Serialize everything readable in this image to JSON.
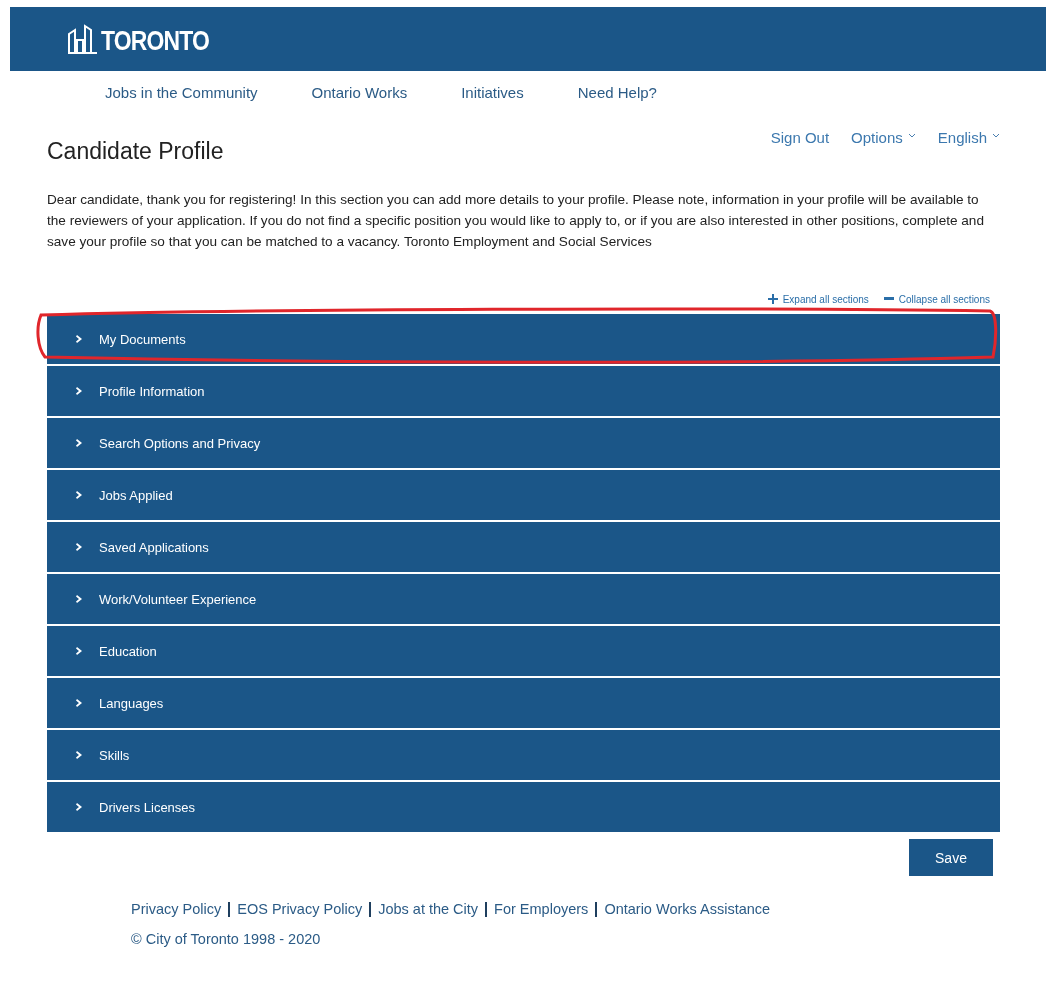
{
  "logo": {
    "text": "TORONTO"
  },
  "nav": [
    "Jobs in the Community",
    "Ontario Works",
    "Initiatives",
    "Need Help?"
  ],
  "user_menu": [
    {
      "label": "Sign Out",
      "dropdown": false
    },
    {
      "label": "Options",
      "dropdown": true
    },
    {
      "label": "English",
      "dropdown": true
    }
  ],
  "title": "Candidate Profile",
  "intro": "Dear candidate, thank you for registering! In this section you can add more details to your profile. Please note, information in your profile will be available to the reviewers of your application. If you do not find a specific position you would like to apply to, or if you are also interested in other positions, complete and save your profile so that you can be matched to a vacancy. Toronto Employment and Social Services",
  "section_controls": [
    {
      "kind": "expand",
      "label": "Expand all sections"
    },
    {
      "kind": "collapse",
      "label": "Collapse all sections"
    }
  ],
  "sections": [
    {
      "label": "My Documents",
      "expanded": false,
      "circled": true
    },
    {
      "label": "Profile Information",
      "expanded": false,
      "circled": false
    },
    {
      "label": "Search Options and Privacy",
      "expanded": false,
      "circled": false
    },
    {
      "label": "Jobs Applied",
      "expanded": false,
      "circled": false
    },
    {
      "label": "Saved Applications",
      "expanded": false,
      "circled": false
    },
    {
      "label": "Work/Volunteer Experience",
      "expanded": false,
      "circled": false
    },
    {
      "label": "Education",
      "expanded": false,
      "circled": false
    },
    {
      "label": "Languages",
      "expanded": false,
      "circled": false
    },
    {
      "label": "Skills",
      "expanded": false,
      "circled": false
    },
    {
      "label": "Drivers Licenses",
      "expanded": false,
      "circled": false
    }
  ],
  "save_button": "Save",
  "footer_links": [
    "Privacy Policy",
    "EOS Privacy Policy",
    "Jobs at the City",
    "For Employers",
    "Ontario Works Assistance"
  ],
  "copyright": "© City of Toronto 1998 - 2020"
}
